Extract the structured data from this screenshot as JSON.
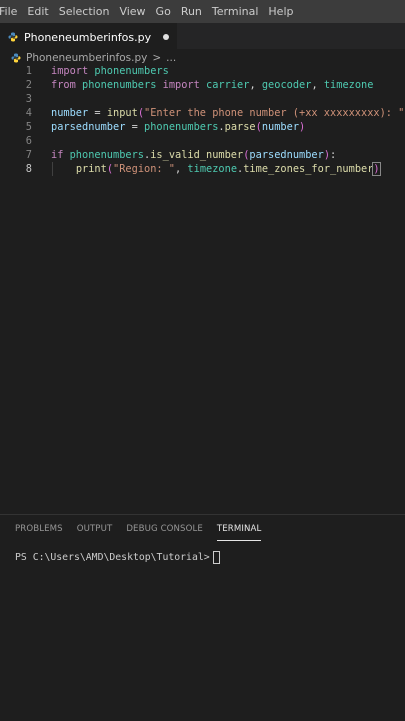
{
  "menubar": {
    "items": [
      "File",
      "Edit",
      "Selection",
      "View",
      "Go",
      "Run",
      "Terminal",
      "Help"
    ]
  },
  "tab": {
    "filename": "Phoneneumberinfos.py"
  },
  "breadcrumb": {
    "file": "Phoneneumberinfos.py",
    "sep": ">",
    "more": "..."
  },
  "editor": {
    "active_line": 8,
    "lines": [
      {
        "num": "1",
        "tokens": [
          [
            "kw",
            "import"
          ],
          [
            "t",
            " "
          ],
          [
            "mod",
            "phonenumbers"
          ]
        ]
      },
      {
        "num": "2",
        "tokens": [
          [
            "kw",
            "from"
          ],
          [
            "t",
            " "
          ],
          [
            "mod",
            "phonenumbers"
          ],
          [
            "t",
            " "
          ],
          [
            "kw",
            "import"
          ],
          [
            "t",
            " "
          ],
          [
            "mod",
            "carrier"
          ],
          [
            "t",
            ", "
          ],
          [
            "mod",
            "geocoder"
          ],
          [
            "t",
            ", "
          ],
          [
            "mod",
            "timezone"
          ]
        ]
      },
      {
        "num": "3",
        "tokens": []
      },
      {
        "num": "4",
        "tokens": [
          [
            "var",
            "number"
          ],
          [
            "t",
            " = "
          ],
          [
            "fn",
            "input"
          ],
          [
            "brk",
            "("
          ],
          [
            "str",
            "\"Enter the phone number (+xx xxxxxxxxx): \""
          ],
          [
            "brk",
            ")"
          ]
        ]
      },
      {
        "num": "5",
        "tokens": [
          [
            "var",
            "parsednumber"
          ],
          [
            "t",
            " = "
          ],
          [
            "mod",
            "phonenumbers"
          ],
          [
            "t",
            "."
          ],
          [
            "fn",
            "parse"
          ],
          [
            "brk",
            "("
          ],
          [
            "var",
            "number"
          ],
          [
            "brk",
            ")"
          ]
        ]
      },
      {
        "num": "6",
        "tokens": []
      },
      {
        "num": "7",
        "tokens": [
          [
            "kw",
            "if"
          ],
          [
            "t",
            " "
          ],
          [
            "mod",
            "phonenumbers"
          ],
          [
            "t",
            "."
          ],
          [
            "fn",
            "is_valid_number"
          ],
          [
            "brk",
            "("
          ],
          [
            "var",
            "parsednumber"
          ],
          [
            "brk",
            ")"
          ],
          [
            "t",
            ":"
          ]
        ]
      },
      {
        "num": "8",
        "tokens": [
          [
            "t",
            "    "
          ],
          [
            "fn",
            "print"
          ],
          [
            "brk",
            "("
          ],
          [
            "str",
            "\"Region: \""
          ],
          [
            "t",
            ", "
          ],
          [
            "mod",
            "timezone"
          ],
          [
            "t",
            "."
          ],
          [
            "fn",
            "time_zones_for_number"
          ],
          [
            "brk",
            ")"
          ]
        ]
      }
    ]
  },
  "panel": {
    "tabs": [
      "PROBLEMS",
      "OUTPUT",
      "DEBUG CONSOLE",
      "TERMINAL"
    ],
    "active_tab": "TERMINAL",
    "terminal_prompt": "PS C:\\Users\\AMD\\Desktop\\Tutorial> "
  },
  "colors": {
    "background": "#1e1e1e",
    "menubar": "#3c3c3c",
    "keyword": "#c586c0",
    "module": "#4ec9b0",
    "variable": "#9cdcfe",
    "function": "#dcdcaa",
    "string": "#ce9178"
  }
}
